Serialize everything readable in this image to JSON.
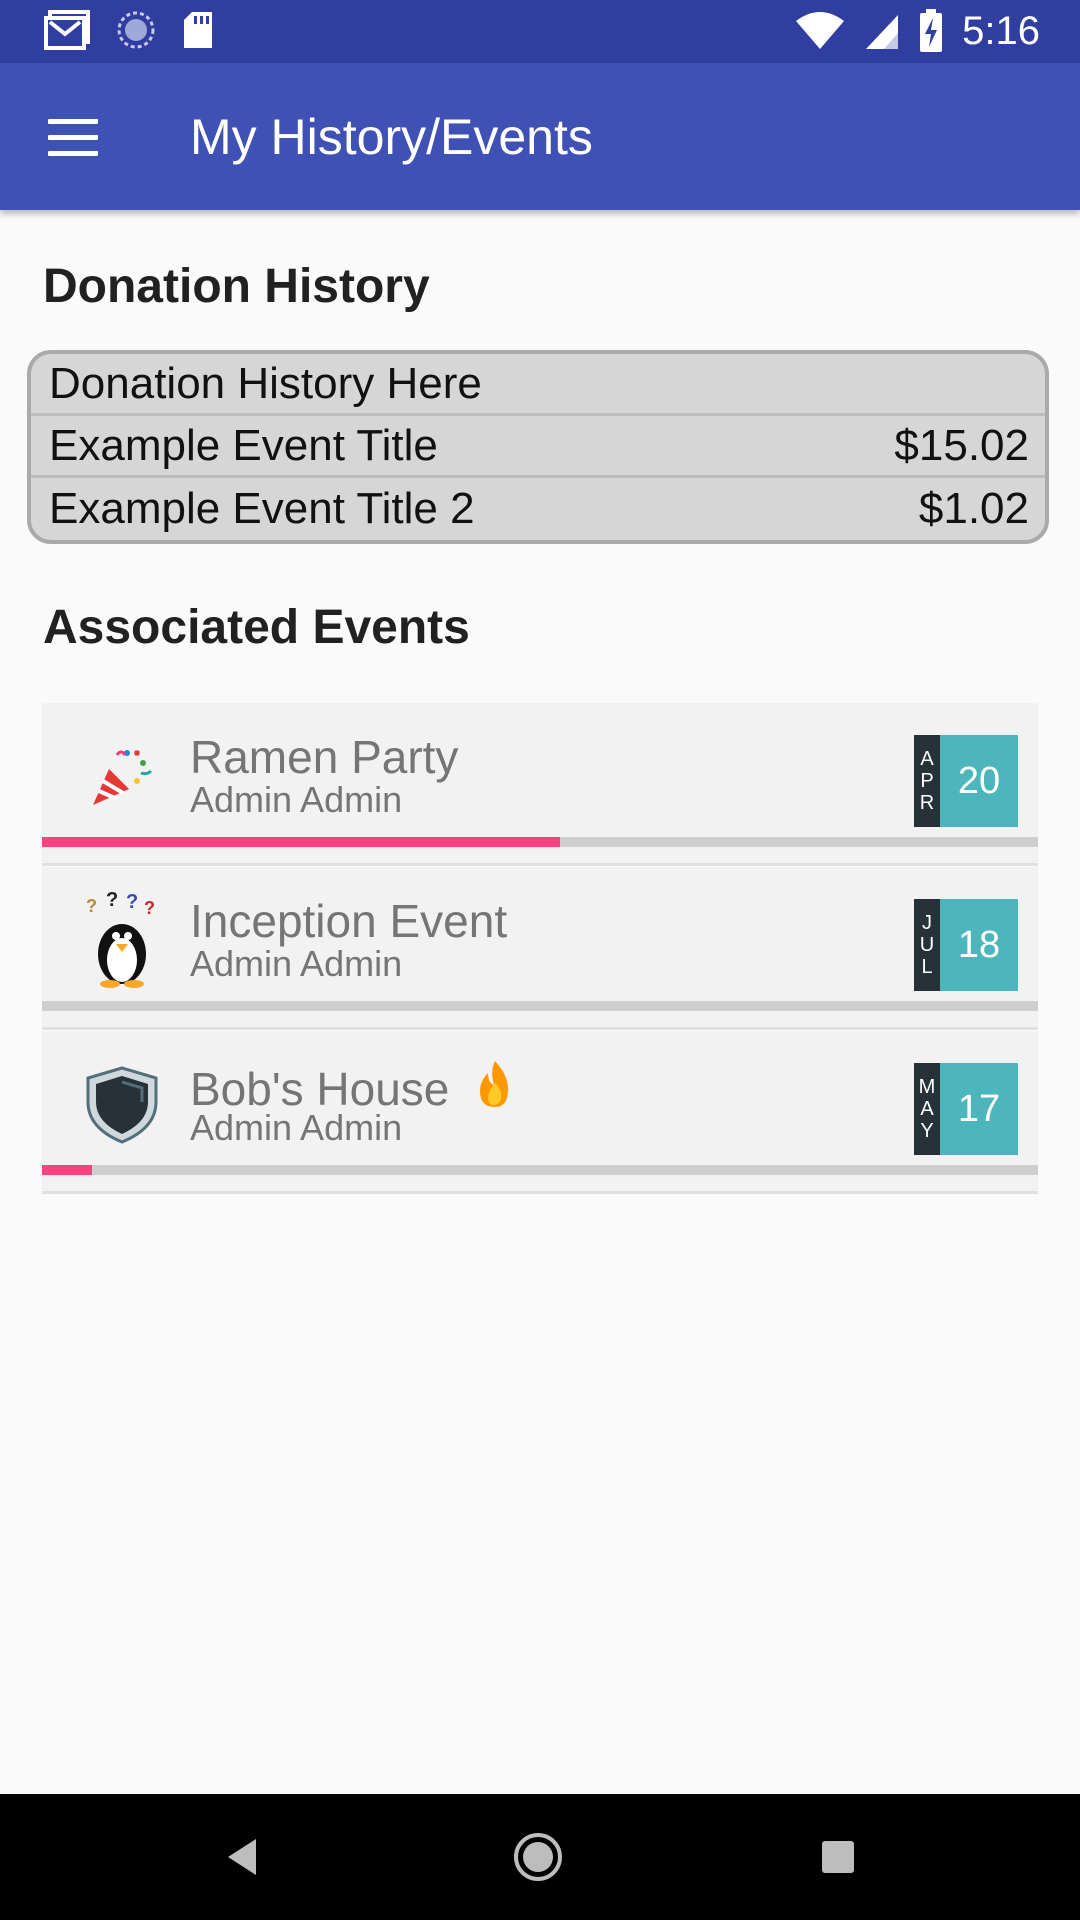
{
  "status_bar": {
    "time": "5:16",
    "left_icons": [
      "gmail-icon",
      "sync-icon",
      "sd-card-icon"
    ],
    "right_icons": [
      "wifi-icon",
      "signal-icon",
      "battery-charging-icon"
    ]
  },
  "app_bar": {
    "title": "My History/Events",
    "menu_icon": "hamburger-menu-icon"
  },
  "donation_history": {
    "heading": "Donation History",
    "header_row": "Donation History Here",
    "rows": [
      {
        "title": "Example Event Title",
        "amount": "$15.02"
      },
      {
        "title": "Example Event Title 2",
        "amount": "$1.02"
      }
    ]
  },
  "associated_events": {
    "heading": "Associated Events",
    "events": [
      {
        "title": "Ramen Party",
        "subtitle": "Admin Admin",
        "month": [
          "A",
          "P",
          "R"
        ],
        "day": "20",
        "icon": "party-popper-icon",
        "progress": 0.52
      },
      {
        "title": "Inception Event",
        "subtitle": "Admin Admin",
        "month": [
          "J",
          "U",
          "L"
        ],
        "day": "18",
        "icon": "penguin-icon",
        "progress": 0.0
      },
      {
        "title": "Bob's House",
        "subtitle": "Admin Admin",
        "month": [
          "M",
          "A",
          "Y"
        ],
        "day": "17",
        "icon": "shield-icon",
        "progress": 0.05,
        "title_emoji": "fire-icon"
      }
    ]
  },
  "colors": {
    "status_bar": "#303f9f",
    "app_bar": "#3f51b5",
    "progress_accent": "#ff4081",
    "date_day_bg": "#4db6bd",
    "date_month_bg": "#263238"
  },
  "nav_bar": {
    "buttons": [
      "back-icon",
      "home-icon",
      "recents-icon"
    ]
  }
}
